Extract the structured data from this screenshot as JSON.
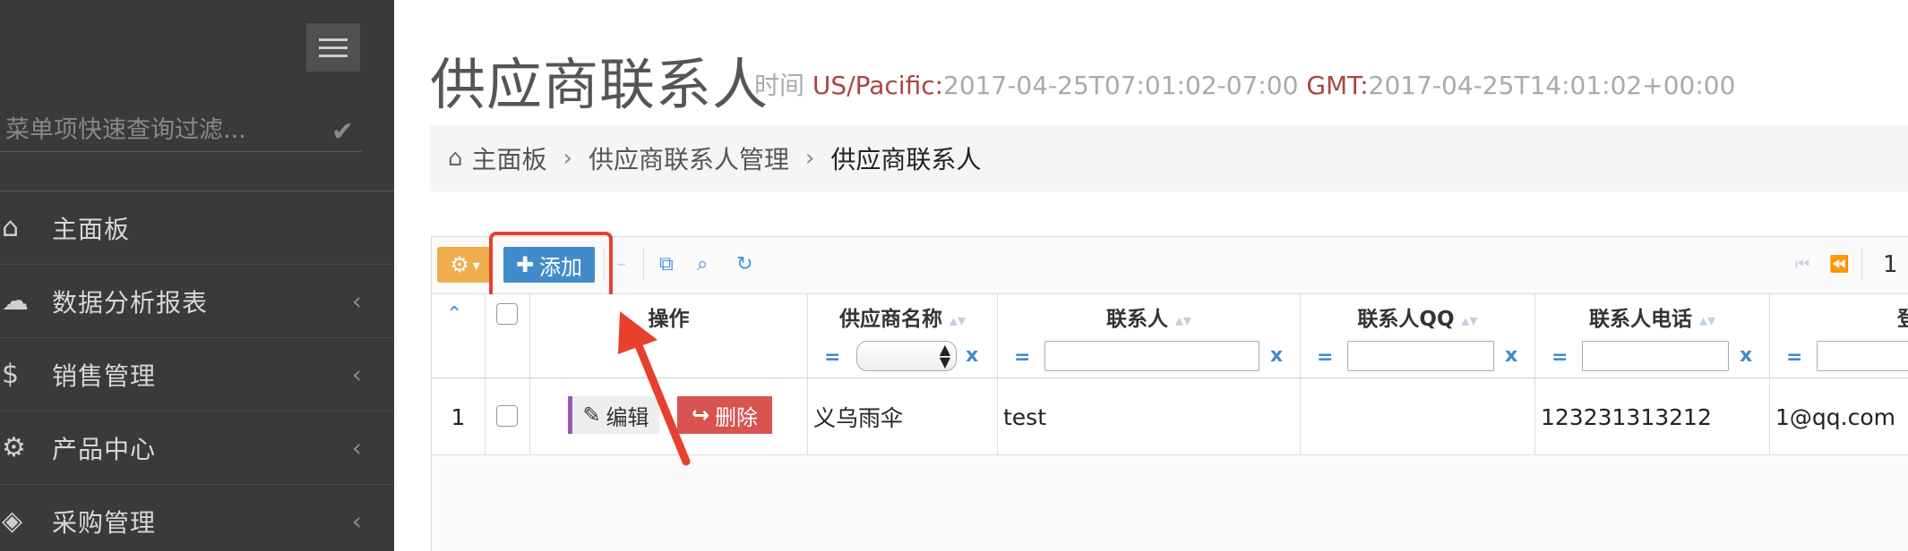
{
  "sidebar": {
    "filter_placeholder": "菜单项快速查询过滤...",
    "items": [
      {
        "label": "主面板",
        "icon": "home-icon",
        "glyph": "⌂"
      },
      {
        "label": "数据分析报表",
        "icon": "cloud-icon",
        "glyph": "☁"
      },
      {
        "label": "销售管理",
        "icon": "dollar-icon",
        "glyph": "$"
      },
      {
        "label": "产品中心",
        "icon": "gears-icon",
        "glyph": "⚙"
      },
      {
        "label": "采购管理",
        "icon": "cube-icon",
        "glyph": "◈"
      }
    ]
  },
  "header": {
    "title": "供应商联系人",
    "time_label": "时间",
    "tz1_label": "US/Pacific:",
    "tz1_value": "2017-04-25T07:01:02-07:00",
    "tz2_label": "GMT:",
    "tz2_value": "2017-04-25T14:01:02+00:00"
  },
  "breadcrumb": [
    "主面板",
    "供应商联系人管理",
    "供应商联系人"
  ],
  "toolbar": {
    "add_label": "添加",
    "page_number": "1"
  },
  "columns": {
    "actions": "操作",
    "supplier": "供应商名称",
    "contact": "联系人",
    "qq": "联系人QQ",
    "phone": "联系人电话",
    "email_partial": "登"
  },
  "filter": {
    "eq": "=",
    "clear": "x"
  },
  "rows": [
    {
      "index": "1",
      "edit_label": "编辑",
      "delete_label": "删除",
      "supplier": "义乌雨伞",
      "contact": "test",
      "qq": "",
      "phone": "123231313212",
      "email": "1@qq.com"
    }
  ],
  "colors": {
    "sidebar_bg": "#3a3a3a",
    "primary": "#428bca",
    "warning": "#f0ad4e",
    "danger": "#d9534f",
    "highlight": "#e8402e"
  }
}
